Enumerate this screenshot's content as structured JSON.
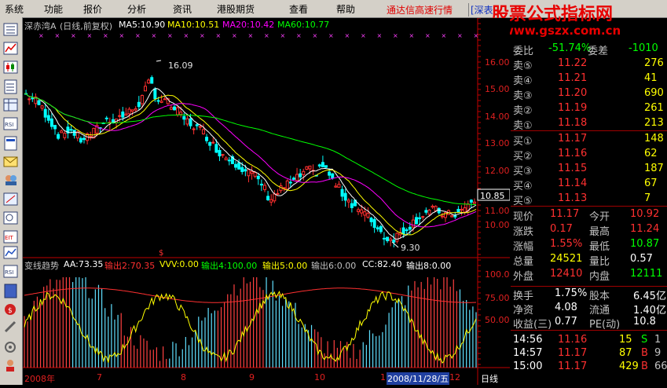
{
  "menu": [
    "系统",
    "功能",
    "报价",
    "分析",
    "资讯",
    "港股期货",
    "查看",
    "帮助"
  ],
  "marquee": "通达信高速行情",
  "stock_code_fragment": "[深表",
  "brand": {
    "title": "股票公式指标网",
    "url": "www.gszx.com.cn"
  },
  "main_header": {
    "name": "深赤湾A",
    "period": "(日线,前复权)",
    "ma5": "MA5:10.90",
    "ma10": "MA10:10.51",
    "ma20": "MA20:10.42",
    "ma60": "MA60:10.77"
  },
  "price_marks": {
    "high": "16.09",
    "low": "9.30",
    "current": "10.85"
  },
  "price_axis": [
    "16.00",
    "15.00",
    "14.00",
    "13.00",
    "12.00",
    "11.00",
    "10.00"
  ],
  "indicator_header": {
    "name": "变线趋势",
    "aa": "AA:73.35",
    "out2": "输出2:70.35",
    "vvv": "VVV:0.00",
    "out4": "输出4:100.00",
    "out5": "输出5:0.00",
    "out6": "输出6:0.00",
    "cc": "CC:82.40",
    "out8": "输出8:0.00"
  },
  "indicator_axis": [
    "100.0",
    "75.00",
    "50.00"
  ],
  "x_axis": [
    "2008年",
    "7",
    "8",
    "9",
    "10",
    "1",
    "2008/11/28/五",
    "12"
  ],
  "period_tab": "日线",
  "quote_panel": {
    "top_row": {
      "label_l": "委比",
      "val_l": "-51.74%",
      "label_r": "委差",
      "val_r": "-1010"
    },
    "asks": [
      {
        "label": "卖⑤",
        "price": "11.22",
        "vol": "276"
      },
      {
        "label": "卖④",
        "price": "11.21",
        "vol": "41"
      },
      {
        "label": "卖③",
        "price": "11.20",
        "vol": "690"
      },
      {
        "label": "卖②",
        "price": "11.19",
        "vol": "261"
      },
      {
        "label": "卖①",
        "price": "11.18",
        "vol": "213"
      }
    ],
    "bids": [
      {
        "label": "买①",
        "price": "11.17",
        "vol": "148"
      },
      {
        "label": "买②",
        "price": "11.16",
        "vol": "62"
      },
      {
        "label": "买③",
        "price": "11.15",
        "vol": "187"
      },
      {
        "label": "买④",
        "price": "11.14",
        "vol": "67"
      },
      {
        "label": "买⑤",
        "price": "11.13",
        "vol": "7"
      }
    ],
    "stats": [
      {
        "l1": "现价",
        "v1": "11.17",
        "l2": "今开",
        "v2": "10.92"
      },
      {
        "l1": "涨跌",
        "v1": "0.17",
        "l2": "最高",
        "v2": "11.24"
      },
      {
        "l1": "涨幅",
        "v1": "1.55%",
        "l2": "最低",
        "v2": "10.87"
      },
      {
        "l1": "总量",
        "v1": "24521",
        "l2": "量比",
        "v2": "0.57"
      },
      {
        "l1": "外盘",
        "v1": "12410",
        "l2": "内盘",
        "v2": "12111"
      }
    ],
    "stats2": [
      {
        "l1": "换手",
        "v1": "1.75%",
        "l2": "股本",
        "v2": "6.45亿"
      },
      {
        "l1": "净资",
        "v1": "4.08",
        "l2": "流通",
        "v2": "1.40亿"
      },
      {
        "l1": "收益(三)",
        "v1": "0.77",
        "l2": "PE(动)",
        "v2": "10.8"
      }
    ],
    "ticks": [
      {
        "time": "14:56",
        "price": "11.16",
        "vol": "15",
        "flag": "S",
        "n": "1"
      },
      {
        "time": "14:57",
        "price": "11.17",
        "vol": "87",
        "flag": "B",
        "n": "9"
      },
      {
        "time": "15:00",
        "price": "11.17",
        "vol": "429",
        "flag": "B",
        "n": "66"
      }
    ]
  },
  "colors": {
    "ma5": "#ffffff",
    "ma10": "#ffff00",
    "ma20": "#ff00ff",
    "ma60": "#00ff00",
    "up": "#ff3030",
    "down": "#00ffff",
    "axis": "#c00000"
  }
}
